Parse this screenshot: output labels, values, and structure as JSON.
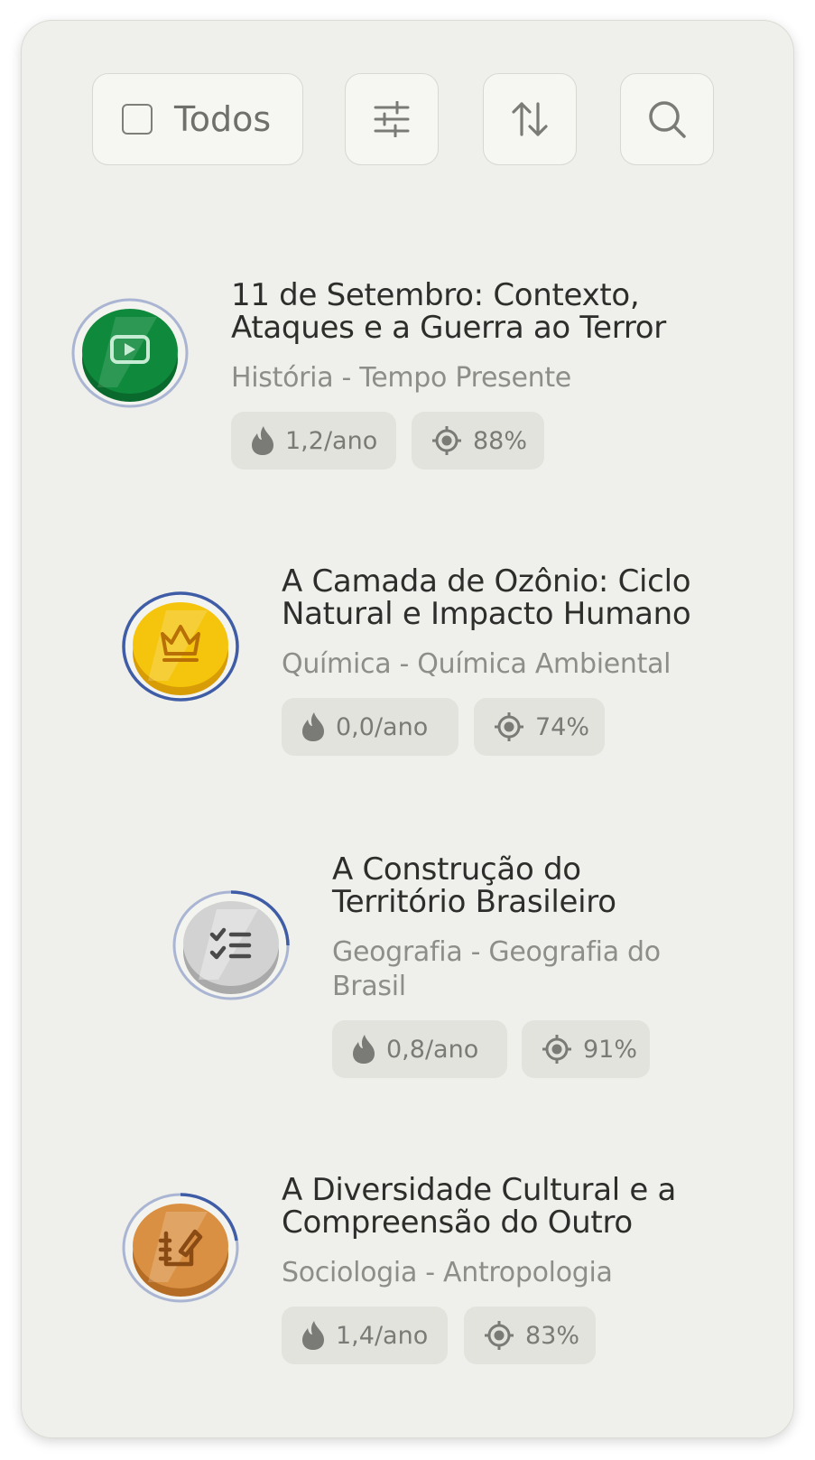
{
  "toolbar": {
    "select_all_label": "Todos"
  },
  "icons": {
    "checkbox": "checkbox-icon",
    "filter": "sliders-icon",
    "sort": "sort-arrows-icon",
    "search": "search-icon",
    "frequency": "flame-icon",
    "accuracy": "target-icon"
  },
  "items": [
    {
      "title_line1": "11 de Setembro: Contexto,",
      "title_line2": "Ataques e a Guerra ao Terror",
      "subtitle_line1": "História - Tempo Presente",
      "subtitle_line2": "",
      "frequency": "1,2/ano",
      "accuracy": "88%",
      "badge_icon": "video-play-icon",
      "badge_color": "#0f8a3c",
      "progress": 0
    },
    {
      "title_line1": "A Camada de Ozônio: Ciclo",
      "title_line2": "Natural e Impacto Humano",
      "subtitle_line1": "Química - Química Ambiental",
      "subtitle_line2": "",
      "frequency": "0,0/ano",
      "accuracy": "74%",
      "badge_icon": "crown-icon",
      "badge_color": "#f2bf0b",
      "progress": 1
    },
    {
      "title_line1": "A Construção do",
      "title_line2": "Território Brasileiro",
      "subtitle_line1": "Geografia - Geografia do",
      "subtitle_line2": "Brasil",
      "frequency": "0,8/ano",
      "accuracy": "91%",
      "badge_icon": "checklist-icon",
      "badge_color": "#cfcfcf",
      "progress": 0.25
    },
    {
      "title_line1": "A Diversidade Cultural e a",
      "title_line2": "Compreensão do Outro",
      "subtitle_line1": "Sociologia - Antropologia",
      "subtitle_line2": "",
      "frequency": "1,4/ano",
      "accuracy": "83%",
      "badge_icon": "writing-hand-icon",
      "badge_color": "#d98f3e",
      "progress": 0.22
    }
  ]
}
